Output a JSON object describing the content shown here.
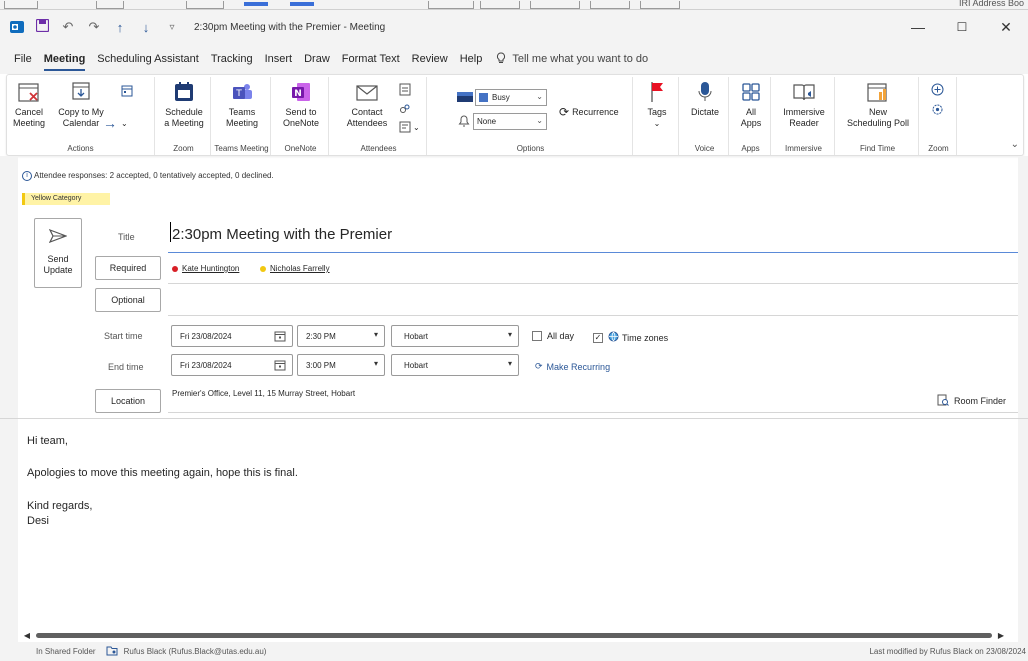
{
  "window": {
    "title": "2:30pm Meeting with the Premier  -  Meeting",
    "behind_text": "IRI Address Boo",
    "minimize": "—",
    "maximize": "☐",
    "close": "✕"
  },
  "menu": {
    "tabs": [
      "File",
      "Meeting",
      "Scheduling Assistant",
      "Tracking",
      "Insert",
      "Draw",
      "Format Text",
      "Review",
      "Help"
    ],
    "active": "Meeting",
    "tell_me": "Tell me what you want to do"
  },
  "ribbon": {
    "actions": {
      "cancel": "Cancel\nMeeting",
      "copy": "Copy to My\nCalendar",
      "label": "Actions"
    },
    "zoom_meeting": {
      "schedule": "Schedule\na Meeting",
      "label": "Zoom"
    },
    "teams": {
      "button": "Teams\nMeeting",
      "label": "Teams Meeting"
    },
    "onenote": {
      "button": "Send to\nOneNote",
      "label": "OneNote"
    },
    "attendees": {
      "contact": "Contact\nAttendees",
      "label": "Attendees"
    },
    "options": {
      "show_as": "Busy",
      "reminder": "None",
      "recurrence": "Recurrence",
      "label": "Options"
    },
    "tags": {
      "button": "Tags"
    },
    "voice": {
      "dictate": "Dictate",
      "label": "Voice"
    },
    "apps": {
      "all_apps": "All\nApps",
      "label": "Apps"
    },
    "immersive": {
      "reader": "Immersive\nReader",
      "label": "Immersive"
    },
    "find_time": {
      "poll": "New\nScheduling Poll",
      "label": "Find Time"
    },
    "zoom2": {
      "label": "Zoom"
    }
  },
  "info": {
    "responses": "Attendee responses: 2 accepted, 0 tentatively accepted, 0 declined.",
    "category": "Yellow Category"
  },
  "form": {
    "send_update": "Send\nUpdate",
    "title_label": "Title",
    "title_value": "2:30pm Meeting with the Premier",
    "required_label": "Required",
    "optional_label": "Optional",
    "attendees": [
      {
        "name": "Kate Huntington",
        "color": "#d81f26"
      },
      {
        "name": "Nicholas Farrelly",
        "color": "#f2c811"
      }
    ],
    "start_label": "Start time",
    "start_date": "Fri 23/08/2024",
    "start_time": "2:30 PM",
    "start_tz": "Hobart",
    "end_label": "End time",
    "end_date": "Fri 23/08/2024",
    "end_time": "3:00 PM",
    "end_tz": "Hobart",
    "all_day": "All day",
    "time_zones": "Time zones",
    "make_recurring": "Make Recurring",
    "location_label": "Location",
    "location_value": "Premier's Office, Level 11, 15 Murray Street, Hobart",
    "room_finder": "Room Finder"
  },
  "body": {
    "lines": [
      "Hi team,",
      "Apologies to move this meeting again,  hope this is final.",
      "Kind regards,",
      "Desi"
    ]
  },
  "status": {
    "folder": "In Shared Folder",
    "owner": "Rufus Black (Rufus.Black@utas.edu.au)",
    "modified": "Last modified by Rufus Black on 23/08/2024"
  }
}
